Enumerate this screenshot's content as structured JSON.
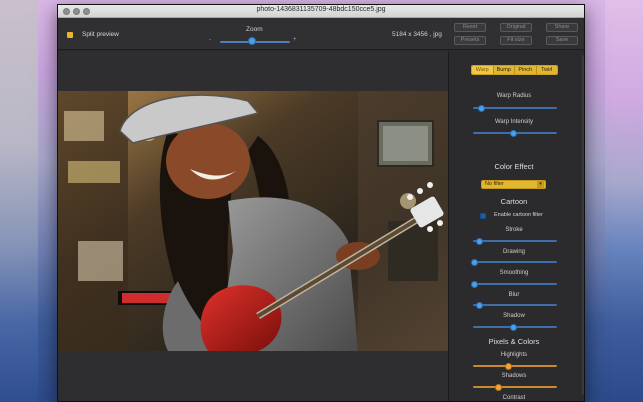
{
  "window": {
    "title": "photo-1436831135709-48bdc150cce5.jpg"
  },
  "toolbar": {
    "split_preview_label": "Split preview",
    "zoom_label": "Zoom",
    "zoom_minus": "-",
    "zoom_plus": "+",
    "zoom_value": 0.45,
    "dimensions": "5184 x 3456 , jpg",
    "buttons": {
      "reset": "Reset",
      "original": "Original",
      "share": "Share",
      "presets": "Presets",
      "fit_size": "Fit size",
      "save": "Save"
    }
  },
  "sidebar": {
    "warp_tabs": [
      "Warp",
      "Bump",
      "Pinch",
      "Twirl"
    ],
    "warp_active": "Warp",
    "warp_radius_label": "Warp Radius",
    "warp_radius_value": 0.1,
    "warp_intensity_label": "Warp Intensity",
    "warp_intensity_value": 0.48,
    "color_effect_heading": "Color Effect",
    "filter_select_value": "No filter",
    "cartoon_heading": "Cartoon",
    "enable_cartoon_label": "Enable cartoon filter",
    "enable_cartoon_checked": true,
    "stroke_label": "Stroke",
    "stroke_value": 0.08,
    "drawing_label": "Drawing",
    "drawing_value": 0.02,
    "smoothing_label": "Smoothing",
    "smoothing_value": 0.02,
    "blur_label": "Blur",
    "blur_value": 0.08,
    "shadow_label": "Shadow",
    "shadow_value": 0.48,
    "pixels_colors_heading": "Pixels & Colors",
    "highlights_label": "Highlights",
    "highlights_value": 0.42,
    "shadows_label": "Shadows",
    "shadows_value": 0.3,
    "contrast_label": "Contrast"
  },
  "colors": {
    "accent_yellow": "#e3b630",
    "slider_blue": "#4aa0ea",
    "slider_orange": "#f0a43a"
  }
}
